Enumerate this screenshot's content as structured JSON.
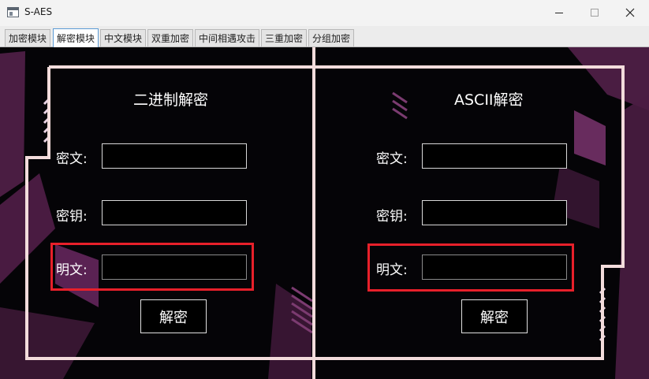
{
  "window": {
    "title": "S-AES",
    "controls": [
      "minimize-icon",
      "maximize-icon",
      "close-icon"
    ]
  },
  "tabs": [
    {
      "label": "加密模块",
      "active": false
    },
    {
      "label": "解密模块",
      "active": true
    },
    {
      "label": "中文模块",
      "active": false
    },
    {
      "label": "双重加密",
      "active": false
    },
    {
      "label": "中间相遇攻击",
      "active": false
    },
    {
      "label": "三重加密",
      "active": false
    },
    {
      "label": "分组加密",
      "active": false
    }
  ],
  "left_panel": {
    "title": "二进制解密",
    "ciphertext_label": "密文:",
    "ciphertext_value": "",
    "key_label": "密钥:",
    "key_value": "",
    "plaintext_label": "明文:",
    "plaintext_value": "",
    "button_label": "解密"
  },
  "right_panel": {
    "title": "ASCII解密",
    "ciphertext_label": "密文:",
    "ciphertext_value": "",
    "key_label": "密钥:",
    "key_value": "",
    "plaintext_label": "明文:",
    "plaintext_value": "",
    "button_label": "解密"
  },
  "colors": {
    "background": "#050407",
    "frame": "#f3dcdc",
    "accent_magenta": "#7a2a6a",
    "highlight": "#e8202a",
    "active_tab_border": "#5b9bd5"
  }
}
